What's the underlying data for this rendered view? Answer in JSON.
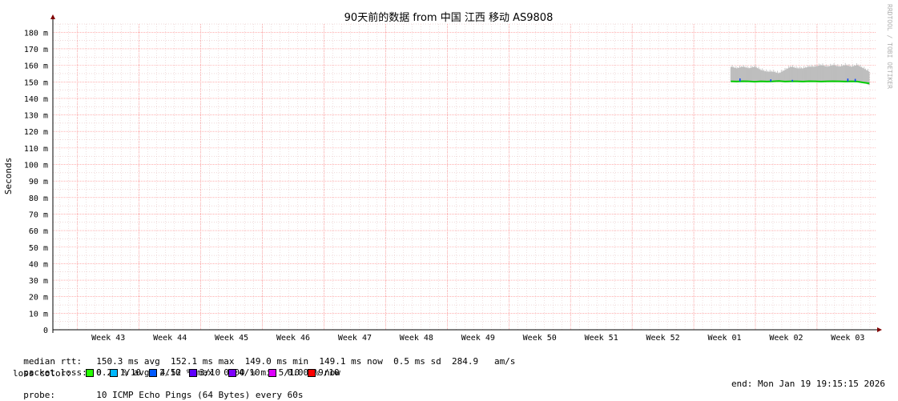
{
  "chart_data": {
    "type": "area",
    "title": "90天前的数据 from 中国 江西 移动 AS9808",
    "ylabel": "Seconds",
    "watermark": "RRDTOOL / TOBI OETIKER",
    "ylim": [
      0,
      185
    ],
    "y_unit": "m",
    "y_ticks": [
      "0",
      "10 m",
      "20 m",
      "30 m",
      "40 m",
      "50 m",
      "60 m",
      "70 m",
      "80 m",
      "90 m",
      "100 m",
      "110 m",
      "120 m",
      "130 m",
      "140 m",
      "150 m",
      "160 m",
      "170 m",
      "180 m"
    ],
    "x_ticks": [
      "Week 43",
      "Week 44",
      "Week 45",
      "Week 46",
      "Week 47",
      "Week 48",
      "Week 49",
      "Week 50",
      "Week 51",
      "Week 52",
      "Week 01",
      "Week 02",
      "Week 03"
    ],
    "x_range_weeks": [
      42.6,
      55.95
    ],
    "series": [
      {
        "kind": "smoke_band",
        "color": "#c0c0c0",
        "x_start_week": 53.6,
        "x_end_week": 55.85,
        "low": [
          150,
          150,
          150,
          151,
          150,
          150,
          150,
          150,
          151,
          150,
          150,
          150,
          150,
          151,
          150,
          150,
          150,
          151,
          150,
          150,
          150,
          150,
          150,
          148
        ],
        "high": [
          159,
          158,
          159,
          158,
          159,
          157,
          156,
          156,
          155,
          157,
          159,
          158,
          158,
          159,
          159,
          160,
          159,
          160,
          159,
          160,
          159,
          160,
          158,
          156
        ]
      },
      {
        "kind": "median",
        "color": "#00cc00",
        "x_start_week": 53.6,
        "x_end_week": 55.85,
        "values": [
          150.3,
          150.2,
          150.4,
          150.3,
          150.1,
          150.3,
          150.2,
          150.3,
          150.5,
          150.2,
          150.3,
          150.3,
          150.2,
          150.4,
          150.3,
          150.2,
          150.3,
          150.4,
          150.3,
          150.2,
          150.3,
          150.2,
          149.6,
          149.1
        ]
      }
    ],
    "spikes_blue": [
      {
        "x_week": 53.75,
        "value": 152.1
      },
      {
        "x_week": 54.25,
        "value": 151.5
      },
      {
        "x_week": 54.6,
        "value": 151.2
      },
      {
        "x_week": 55.5,
        "value": 152.0
      },
      {
        "x_week": 55.62,
        "value": 151.8
      }
    ]
  },
  "stats": {
    "median_label": "median rtt:",
    "median_text": "150.3 ms avg  152.1 ms max  149.0 ms min  149.1 ms now  0.5 ms sd  284.9   am/s",
    "loss_label": "packet loss:",
    "loss_text": "0.21 % avg  4.52 % max  0.00 % min  0.00 % now",
    "color_label": "loss color:",
    "loss_colors": [
      {
        "label": "0",
        "color": "#26ff00"
      },
      {
        "label": "1/10",
        "color": "#00b8ff"
      },
      {
        "label": "2/10",
        "color": "#0059ff"
      },
      {
        "label": "3/10",
        "color": "#5e00ff"
      },
      {
        "label": "4/10",
        "color": "#7e00ff"
      },
      {
        "label": "5/10",
        "color": "#dd00ff"
      },
      {
        "label": "9/10",
        "color": "#ff0000"
      }
    ],
    "probe_label": "probe:",
    "probe_text": "10 ICMP Echo Pings (64 Bytes) every 60s",
    "end_text": "end: Mon Jan 19 19:15:15 2026"
  }
}
